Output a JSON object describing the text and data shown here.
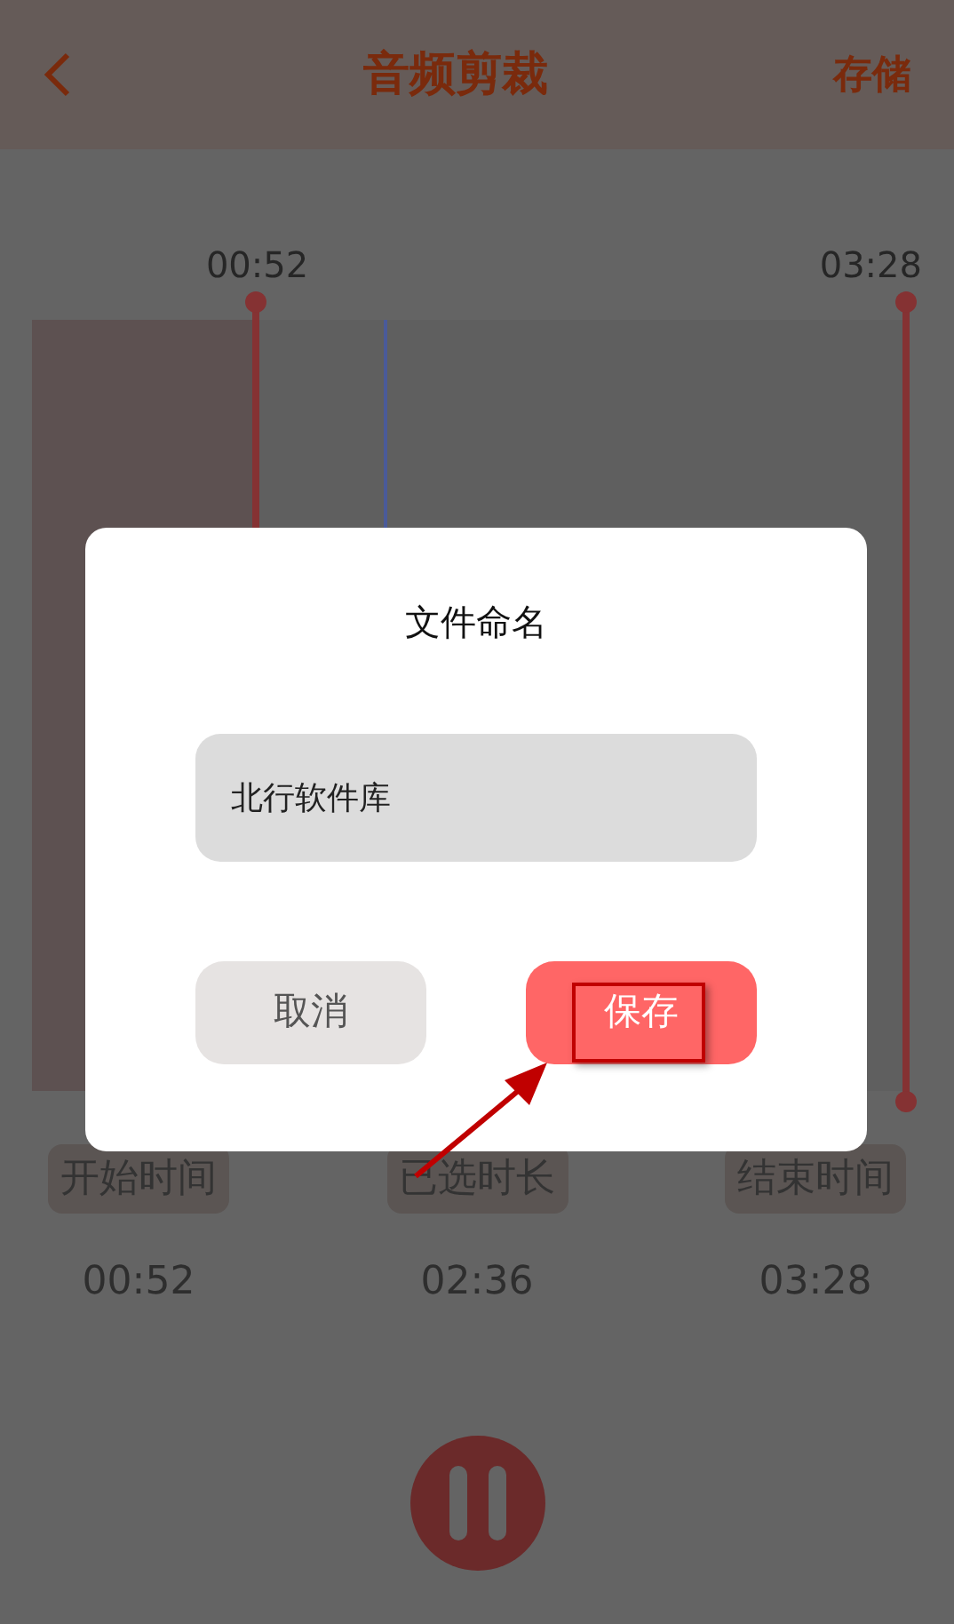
{
  "header": {
    "title": "音频剪裁",
    "action": "存储"
  },
  "timeline": {
    "start_time": "00:52",
    "end_time": "03:28",
    "start_handle": {
      "level": 0.256
    },
    "playhead": {
      "level": 0.402
    },
    "end_handle": {
      "level": 1
    }
  },
  "dialog": {
    "title": "文件命名",
    "input": {
      "value": "北行软件库"
    },
    "buttons": [
      {
        "label": "取消",
        "kind": "cancel"
      },
      {
        "label": "保存",
        "kind": "confirm"
      }
    ]
  },
  "stats": [
    {
      "label": "开始时间",
      "value": "00:52"
    },
    {
      "label": "已选时长",
      "value": "02:36"
    },
    {
      "label": "结束时间",
      "value": "03:28"
    }
  ],
  "player": {
    "playing": true
  }
}
